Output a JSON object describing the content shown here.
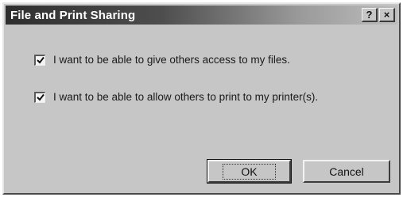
{
  "dialog": {
    "title": "File and Print Sharing",
    "help_button": "?",
    "close_button": "×"
  },
  "options": [
    {
      "label": "I want to be able to give others access to my files.",
      "checked": true
    },
    {
      "label": "I want to be able to allow others to print to my printer(s).",
      "checked": true
    }
  ],
  "buttons": {
    "ok": "OK",
    "cancel": "Cancel"
  }
}
